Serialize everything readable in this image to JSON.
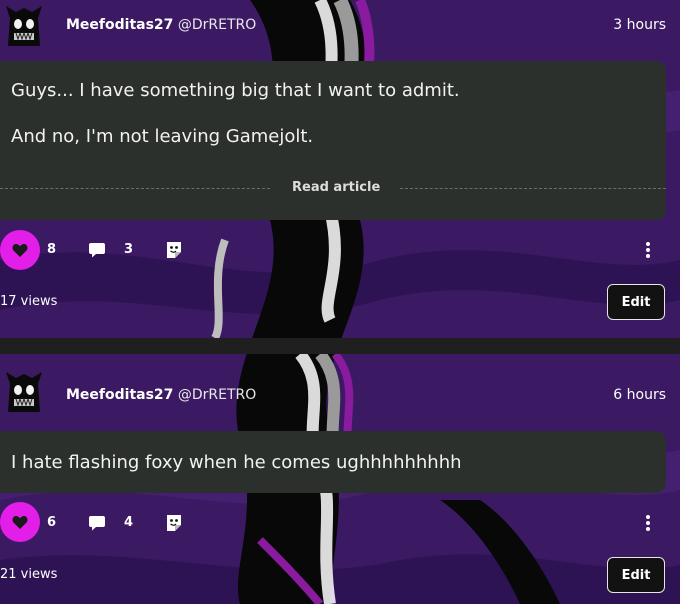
{
  "colors": {
    "like_accent": "#e31ee8",
    "card_background": "#2b302c",
    "background_purple": "#3b1a63"
  },
  "icons": {
    "like": "heart-icon",
    "comment": "comment-icon",
    "sticker": "sticker-icon",
    "more": "more-vertical-icon"
  },
  "posts": [
    {
      "author_name": "Meefoditas27",
      "author_handle": "@DrRETRO",
      "time": "3 hours",
      "paragraphs": [
        "Guys... I have something big that I want to admit.",
        "And no, I'm not leaving Gamejolt."
      ],
      "read_article_label": "Read article",
      "likes": "8",
      "comments": "3",
      "views": "17 views",
      "edit_label": "Edit"
    },
    {
      "author_name": "Meefoditas27",
      "author_handle": "@DrRETRO",
      "time": "6 hours",
      "paragraphs": [
        "I hate flashing foxy when he comes ughhhhhhhhh"
      ],
      "likes": "6",
      "comments": "4",
      "views": "21 views",
      "edit_label": "Edit"
    }
  ]
}
